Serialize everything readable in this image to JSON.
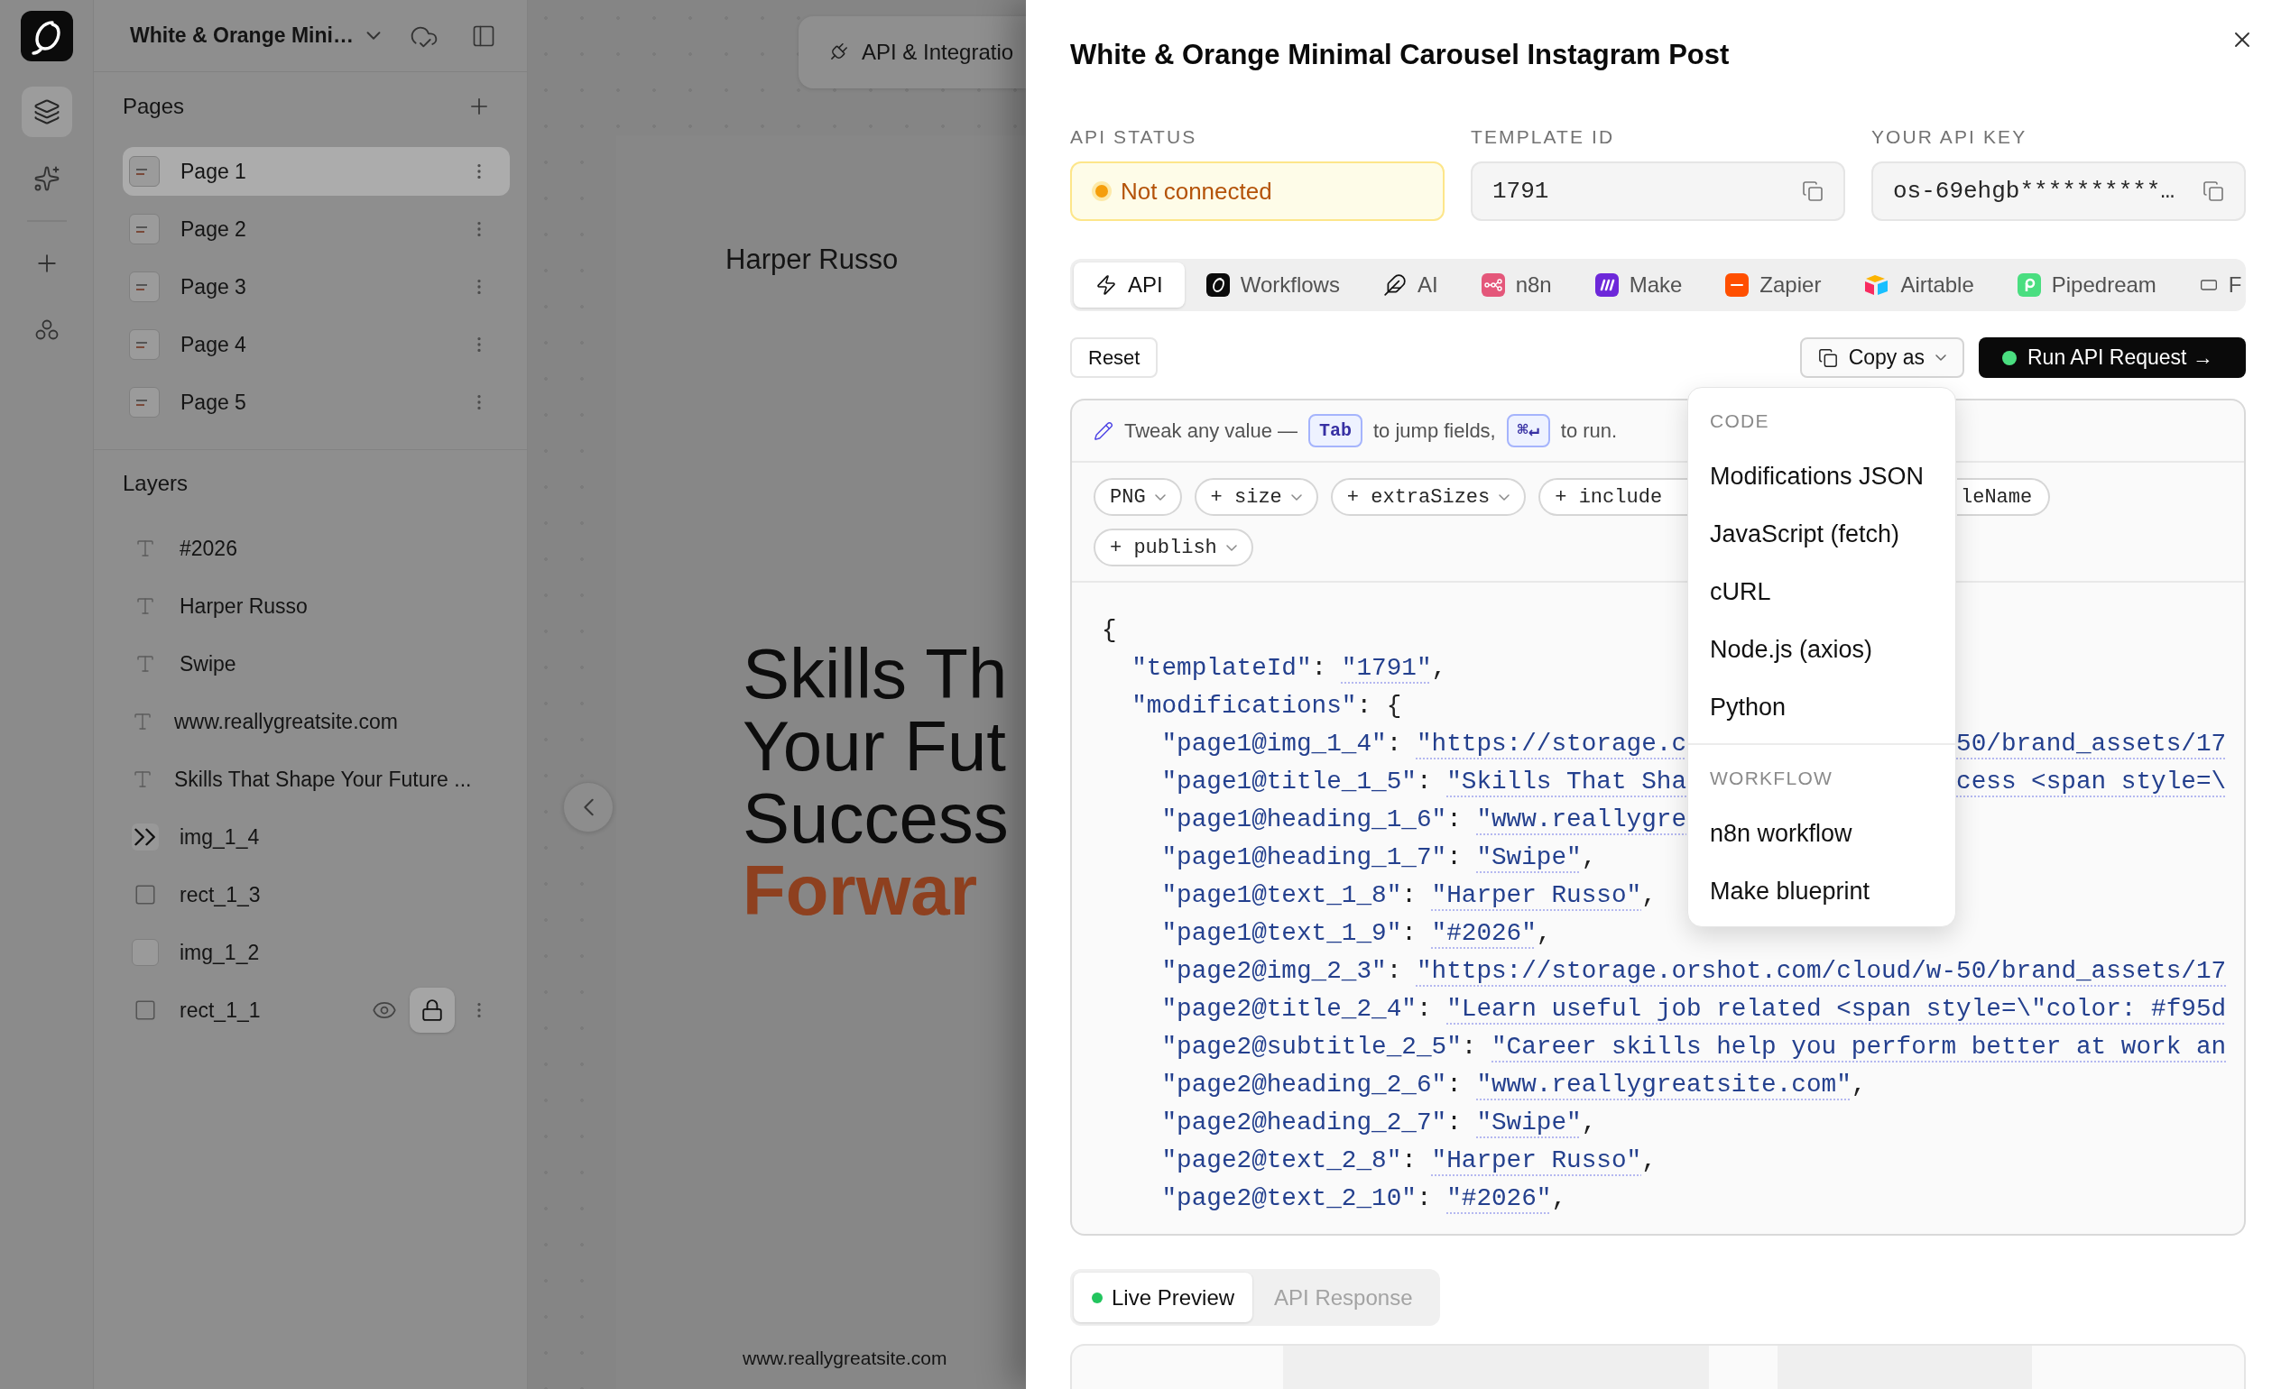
{
  "rail": {
    "items": [
      {
        "selected": true
      },
      {
        "selected": false
      },
      {
        "selected": false
      },
      {
        "selected": false
      }
    ]
  },
  "project": {
    "title": "White & Orange Mini…"
  },
  "pages": {
    "title": "Pages",
    "items": [
      {
        "label": "Page 1",
        "selected": true
      },
      {
        "label": "Page 2",
        "selected": false
      },
      {
        "label": "Page 3",
        "selected": false
      },
      {
        "label": "Page 4",
        "selected": false
      },
      {
        "label": "Page 5",
        "selected": false
      }
    ]
  },
  "layers": {
    "title": "Layers",
    "items": [
      {
        "label": "#2026",
        "kind": "text",
        "hovered": false,
        "locked": false
      },
      {
        "label": "Harper Russo",
        "kind": "text",
        "hovered": false,
        "locked": false
      },
      {
        "label": "Swipe",
        "kind": "text",
        "hovered": false,
        "locked": false
      },
      {
        "label": "www.reallygreatsite.com",
        "kind": "text",
        "hovered": false,
        "locked": false
      },
      {
        "label": "Skills That Shape Your Future ...",
        "kind": "text",
        "hovered": false,
        "locked": false
      },
      {
        "label": "img_1_4",
        "kind": "image",
        "hovered": false,
        "locked": false
      },
      {
        "label": "rect_1_3",
        "kind": "rect",
        "hovered": false,
        "locked": false
      },
      {
        "label": "img_1_2",
        "kind": "empty_image",
        "hovered": false,
        "locked": false
      },
      {
        "label": "rect_1_1",
        "kind": "rect",
        "hovered": true,
        "locked": true
      }
    ]
  },
  "canvas": {
    "toolbar_button": "API & Integratio",
    "artboard": {
      "author": "Harper Russo",
      "headline": [
        {
          "text": "Skills Th",
          "accent": false
        },
        {
          "text": "Your Fut",
          "accent": false
        },
        {
          "text": "Success",
          "accent": false
        },
        {
          "text": "Forwar",
          "accent": true
        }
      ],
      "website": "www.reallygreatsite.com"
    }
  },
  "modal": {
    "title": "White & Orange Minimal Carousel Instagram Post",
    "fields": [
      {
        "label": "API STATUS",
        "kind": "status",
        "value": "Not connected",
        "connected": false
      },
      {
        "label": "TEMPLATE ID",
        "kind": "copyable",
        "value": "1791"
      },
      {
        "label": "YOUR API KEY",
        "kind": "copyable",
        "value": "os-69ehgb**********…"
      }
    ],
    "tabs": [
      {
        "label": "API",
        "selected": true
      },
      {
        "label": "Workflows",
        "selected": false
      },
      {
        "label": "AI",
        "selected": false
      },
      {
        "label": "n8n",
        "selected": false
      },
      {
        "label": "Make",
        "selected": false
      },
      {
        "label": "Zapier",
        "selected": false
      },
      {
        "label": "Airtable",
        "selected": false
      },
      {
        "label": "Pipedream",
        "selected": false
      },
      {
        "label": "F",
        "selected": false
      }
    ],
    "reset": "Reset",
    "copy_as": {
      "label": "Copy as",
      "expanded": true,
      "menu": [
        {
          "title": "CODE",
          "items": [
            "Modifications JSON",
            "JavaScript (fetch)",
            "cURL",
            "Node.js (axios)",
            "Python"
          ]
        },
        {
          "title": "WORKFLOW",
          "items": [
            "n8n workflow",
            "Make blueprint"
          ]
        }
      ]
    },
    "run": "Run API Request →",
    "editor": {
      "hint": [
        {
          "kind": "text",
          "text": "Tweak any value —"
        },
        {
          "kind": "key",
          "text": "Tab"
        },
        {
          "kind": "text",
          "text": "to jump fields,"
        },
        {
          "kind": "key",
          "text": "⌘↵"
        },
        {
          "kind": "text",
          "text": "to run."
        }
      ],
      "chip_rows": [
        [
          {
            "label": "PNG",
            "kind": "dropdown"
          },
          {
            "label": "+ size",
            "kind": "dropdown"
          },
          {
            "label": "+ extraSizes",
            "kind": "dropdown"
          },
          {
            "label": "+ include",
            "kind": "cut_end"
          },
          {
            "label": "leName",
            "kind": "cut_start"
          }
        ],
        [
          {
            "label": "+ publish",
            "kind": "dropdown"
          }
        ]
      ],
      "code": [
        {
          "text": "{",
          "children": [
            {
              "text": "\"templateId\": \"1791\","
            },
            {
              "text": "\"modifications\": {",
              "children": [
                {
                  "text": "\"page1@img_1_4\": \"https://storage.c",
                  "tail": "50/brand_assets/17"
                },
                {
                  "text": "\"page1@title_1_5\": \"Skills That Sha",
                  "tail": "cess <span style=\\"
                },
                {
                  "text": "\"page1@heading_1_6\": \"www.reallygre"
                },
                {
                  "text": "\"page1@heading_1_7\": \"Swipe\","
                },
                {
                  "text": "\"page1@text_1_8\": \"Harper Russo\","
                },
                {
                  "text": "\"page1@text_1_9\": \"#2026\","
                },
                {
                  "text": "\"page2@img_2_3\": \"https://storage.orshot.com/cloud/w-50/brand_assets/17"
                },
                {
                  "text": "\"page2@title_2_4\": \"Learn useful job related <span style=\\\"color: #f95d"
                },
                {
                  "text": "\"page2@subtitle_2_5\": \"Career skills help you perform better at work an"
                },
                {
                  "text": "\"page2@heading_2_6\": \"www.reallygreatsite.com\","
                },
                {
                  "text": "\"page2@heading_2_7\": \"Swipe\","
                },
                {
                  "text": "\"page2@text_2_8\": \"Harper Russo\","
                },
                {
                  "text": "\"page2@text_2_10\": \"#2026\","
                }
              ]
            }
          ]
        }
      ]
    },
    "preview_tabs": [
      {
        "label": "Live Preview",
        "selected": true
      },
      {
        "label": "API Response",
        "selected": false
      }
    ]
  }
}
